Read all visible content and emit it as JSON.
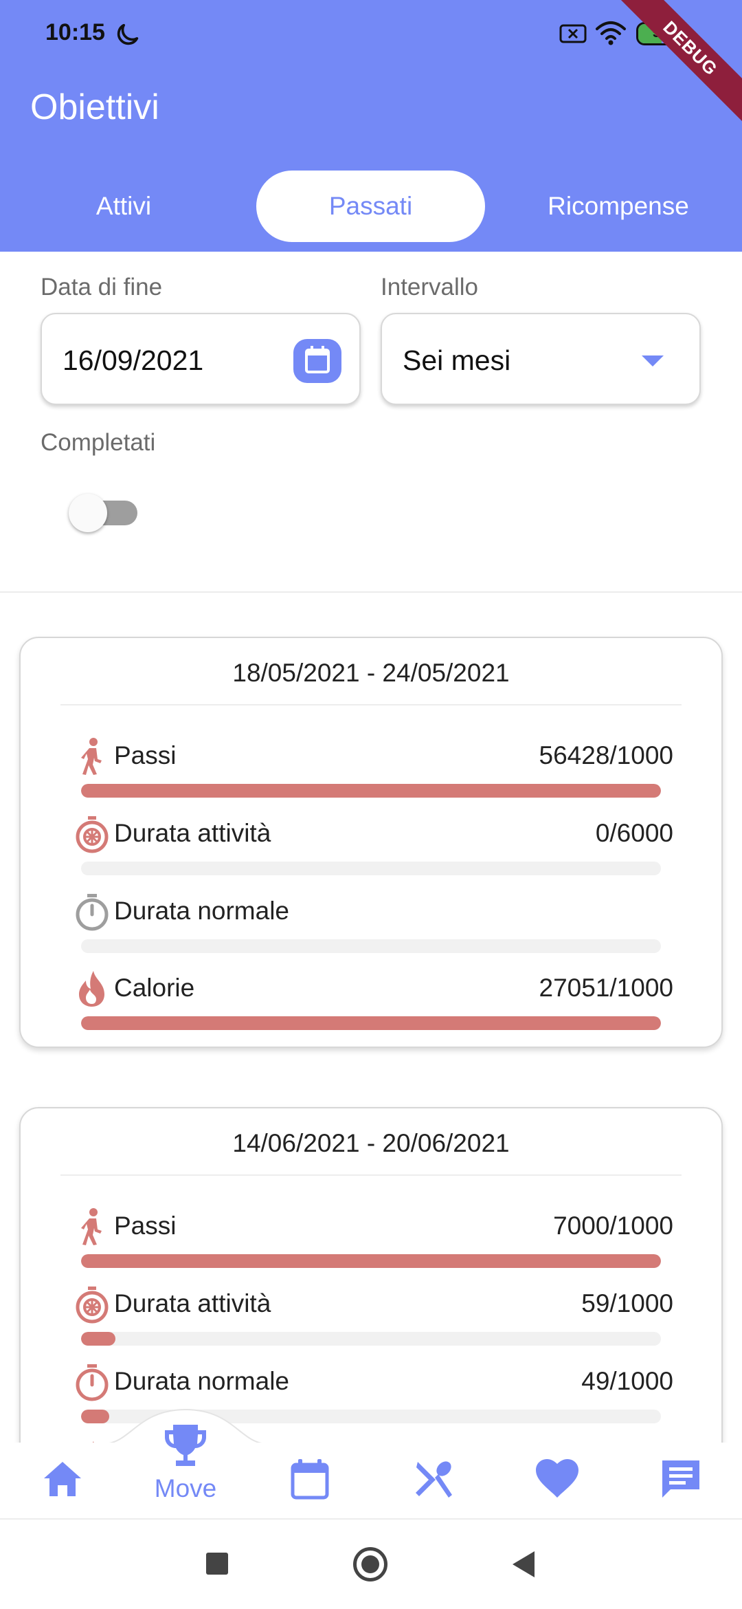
{
  "status_bar": {
    "time": "10:15",
    "battery": "53",
    "battery_level": 0.53,
    "debug_label": "DEBUG"
  },
  "header": {
    "title": "Obiettivi",
    "tabs": [
      {
        "label": "Attivi",
        "active": false
      },
      {
        "label": "Passati",
        "active": true
      },
      {
        "label": "Ricompense",
        "active": false
      }
    ]
  },
  "filters": {
    "end_date_label": "Data di fine",
    "end_date_value": "16/09/2021",
    "interval_label": "Intervallo",
    "interval_value": "Sei mesi",
    "completed_label": "Completati",
    "completed_on": false
  },
  "goals": [
    {
      "period": "18/05/2021 - 24/05/2021",
      "items": [
        {
          "icon": "walking-icon",
          "label": "Passi",
          "value": "56428/1000",
          "progress": 1.0
        },
        {
          "icon": "activity-timer-icon",
          "label": "Durata attività",
          "value": "0/6000",
          "progress": 0.0
        },
        {
          "icon": "stopwatch-icon",
          "label": "Durata normale",
          "value": "",
          "progress": 0.0
        },
        {
          "icon": "fire-icon",
          "label": "Calorie",
          "value": "27051/1000",
          "progress": 1.0
        }
      ]
    },
    {
      "period": "14/06/2021 - 20/06/2021",
      "items": [
        {
          "icon": "walking-icon",
          "label": "Passi",
          "value": "7000/1000",
          "progress": 1.0
        },
        {
          "icon": "activity-timer-icon",
          "label": "Durata attività",
          "value": "59/1000",
          "progress": 0.059
        },
        {
          "icon": "stopwatch-icon",
          "label": "Durata normale",
          "value": "49/1000",
          "progress": 0.049
        },
        {
          "icon": "fire-icon",
          "label": "",
          "value": "",
          "progress": 0.0
        }
      ]
    }
  ],
  "bottom_nav": {
    "items": [
      {
        "icon": "home-icon"
      },
      {
        "icon": "trophy-icon",
        "label": "Move",
        "active": true
      },
      {
        "icon": "calendar-icon"
      },
      {
        "icon": "utensils-icon"
      },
      {
        "icon": "heart-icon"
      },
      {
        "icon": "chat-icon"
      }
    ]
  },
  "colors": {
    "primary": "#7489f6",
    "progress": "#d47a76",
    "icon_inactive": "#9e9e9e",
    "debug_ribbon": "#8e1f3c"
  }
}
